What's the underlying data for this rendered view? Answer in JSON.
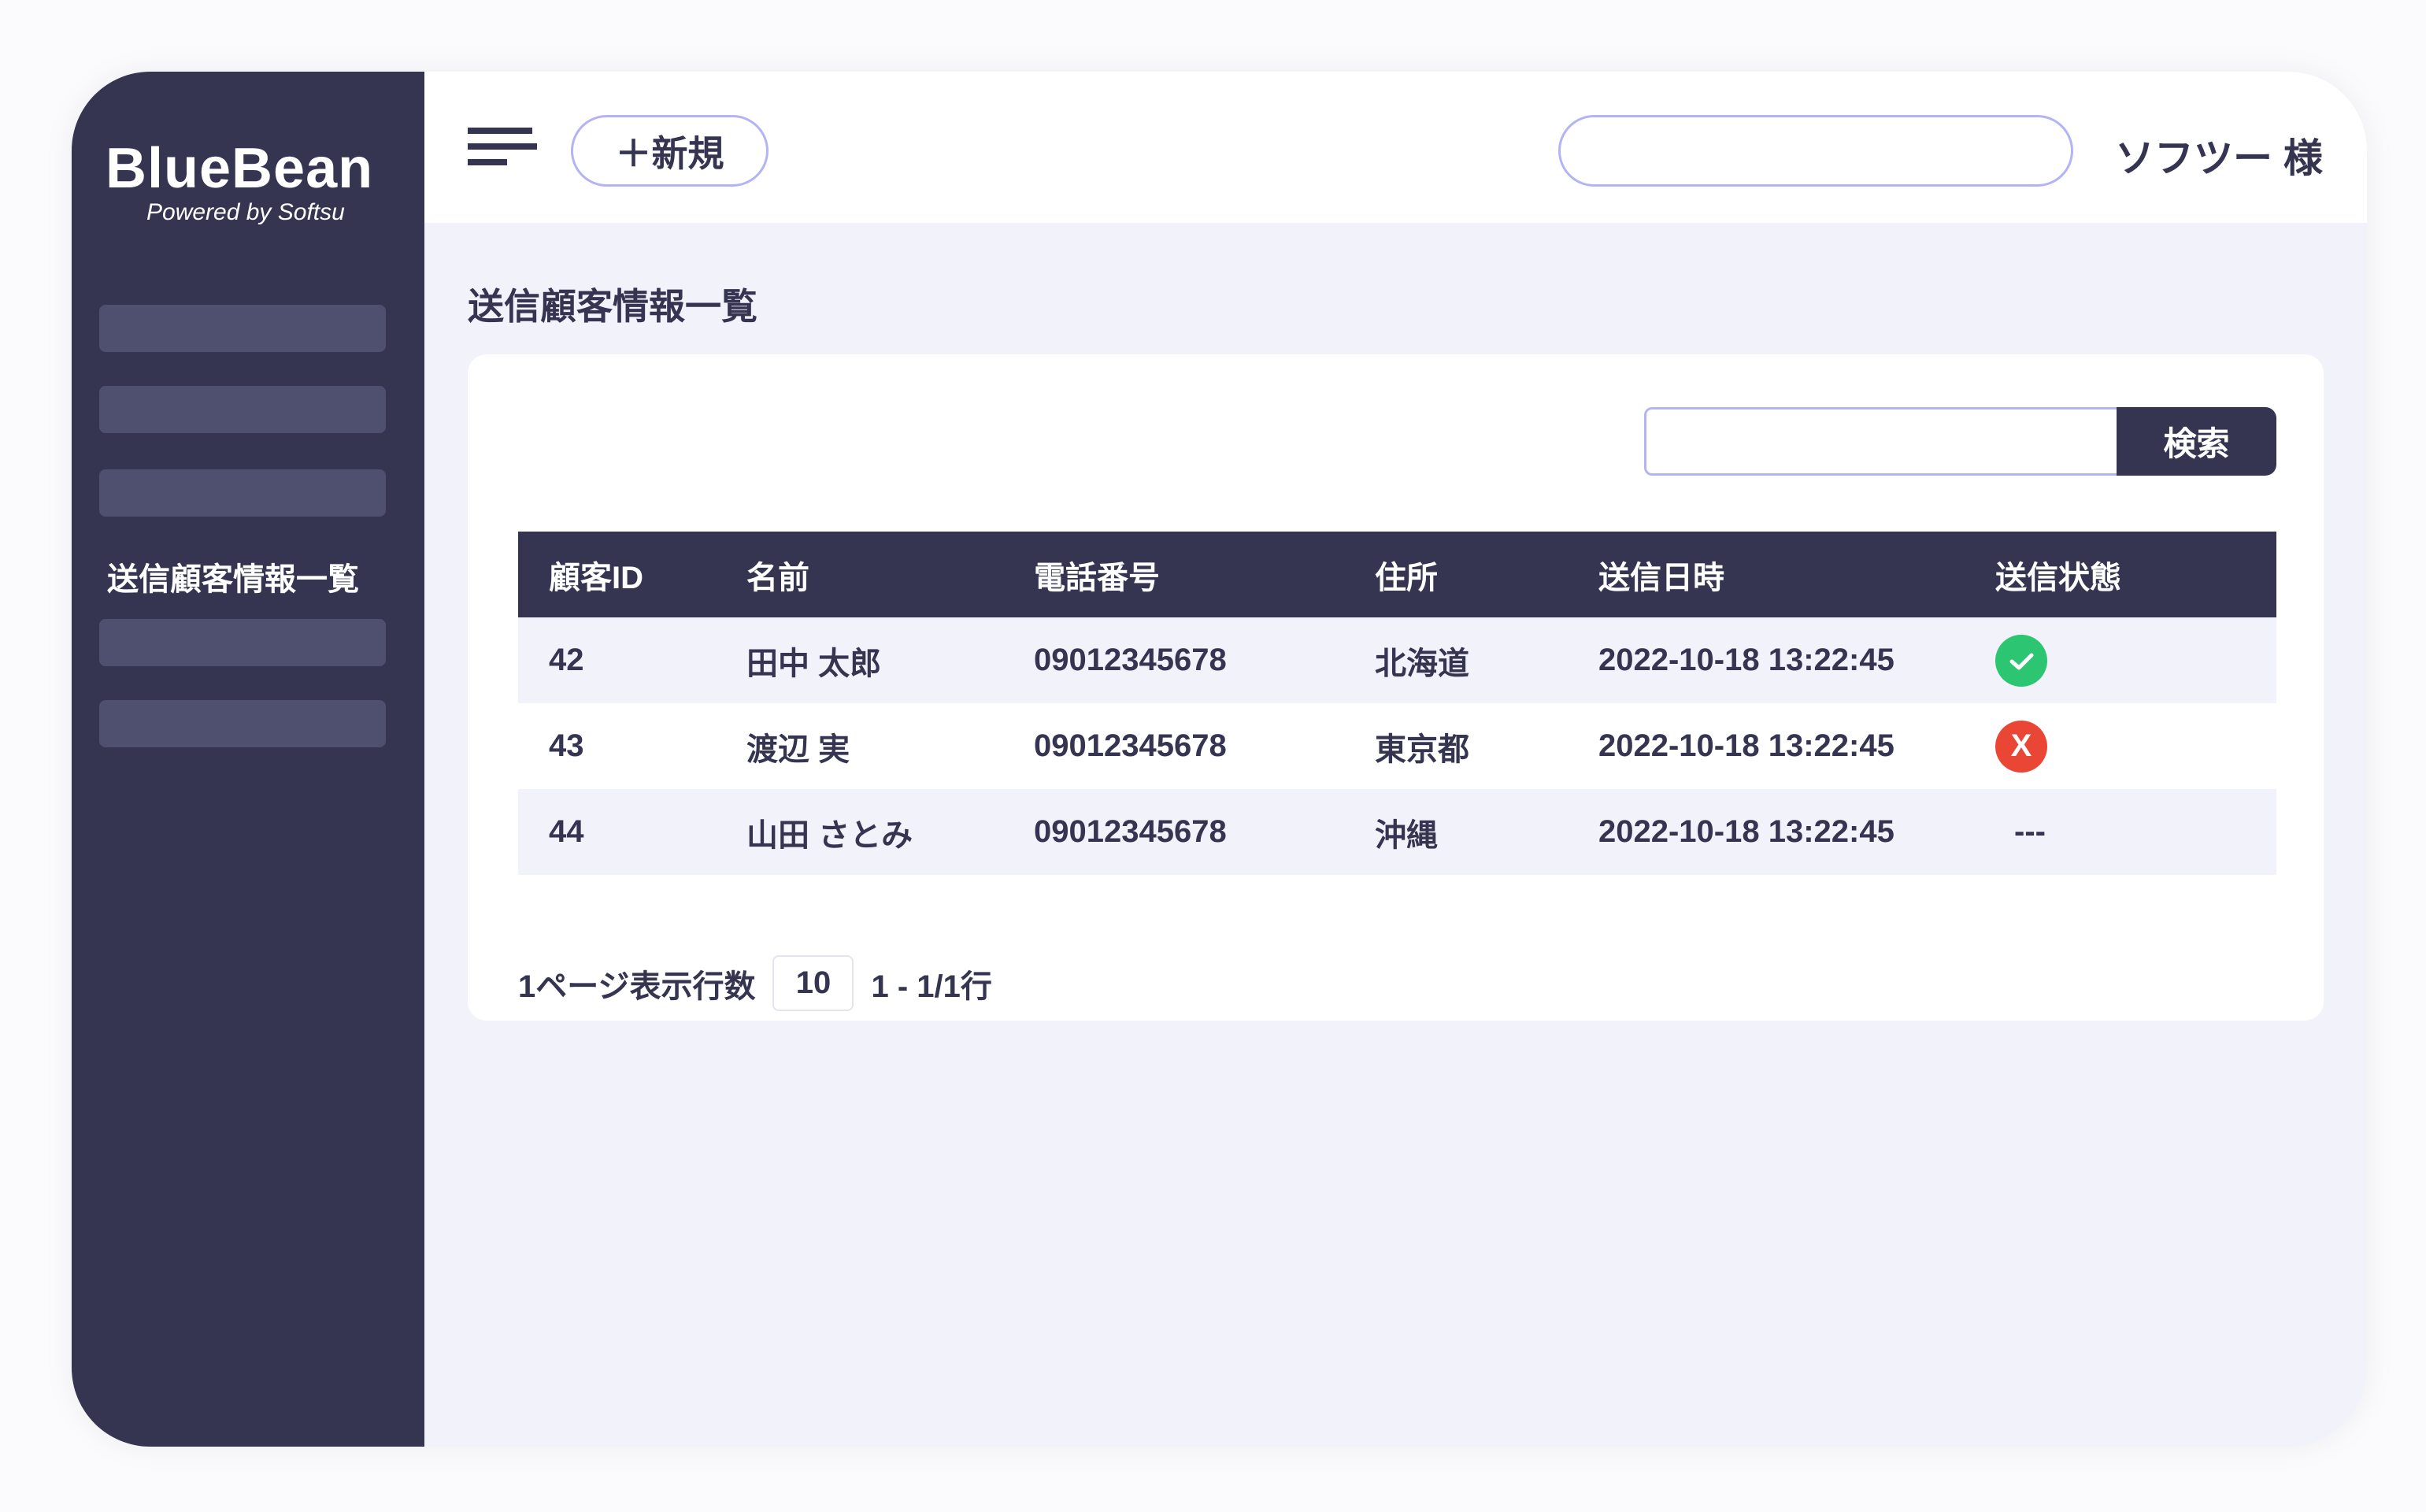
{
  "brand": {
    "name": "BlueBean",
    "tagline": "Powered by Softsu"
  },
  "sidebar": {
    "active_label": "送信顧客情報一覧"
  },
  "header": {
    "new_label": "＋新規",
    "search_value": "",
    "user_name": "ソフツー 様"
  },
  "page": {
    "title": "送信顧客情報一覧",
    "search_value": "",
    "search_button": "検索"
  },
  "table": {
    "columns": [
      "顧客ID",
      "名前",
      "電話番号",
      "住所",
      "送信日時",
      "送信状態"
    ],
    "rows": [
      {
        "id": "42",
        "name": "田中 太郎",
        "phone": "09012345678",
        "address": "北海道",
        "sent_at": "2022-10-18 13:22:45",
        "status": "success",
        "status_text": ""
      },
      {
        "id": "43",
        "name": "渡辺 実",
        "phone": "09012345678",
        "address": "東京都",
        "sent_at": "2022-10-18 13:22:45",
        "status": "failed",
        "status_text": "X"
      },
      {
        "id": "44",
        "name": "山田 さとみ",
        "phone": "09012345678",
        "address": "沖縄",
        "sent_at": "2022-10-18 13:22:45",
        "status": "none",
        "status_text": "---"
      }
    ]
  },
  "pagination": {
    "rows_per_page_label": "1ページ表示行数",
    "rows_per_page": "10",
    "range": "1 - 1/1行"
  },
  "colors": {
    "primary": "#353552",
    "accent_border": "#b3b3f5",
    "success": "#2cc672",
    "error": "#ea4636",
    "background": "#f2f2fb"
  }
}
